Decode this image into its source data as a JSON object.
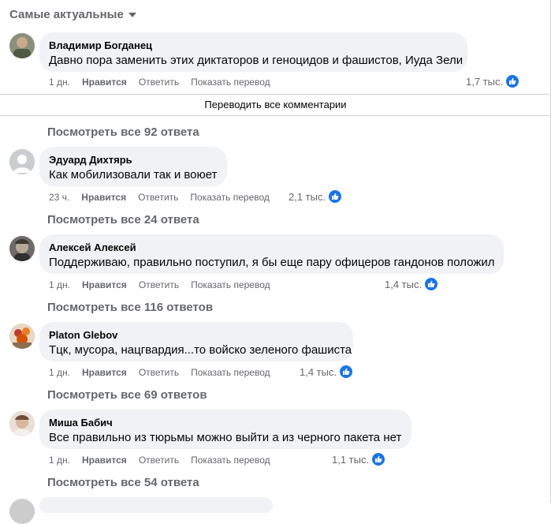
{
  "header": {
    "sort_label": "Самые актуальные"
  },
  "translate_all": "Переводить все комментарии",
  "comments": [
    {
      "author": "Владимир Богданец",
      "text": "Давно пора заменить этих диктаторов и геноцидов и фашистов, Иуда Зели",
      "time": "1 дн.",
      "like": "Нравится",
      "reply": "Ответить",
      "translate": "Показать перевод",
      "reactions": "1,7 тыс.",
      "view_replies": "Посмотреть все 92 ответа"
    },
    {
      "author": "Эдуард Дихтярь",
      "text": "Как мобилизовали так и воюет",
      "time": "23 ч.",
      "like": "Нравится",
      "reply": "Ответить",
      "translate": "Показать перевод",
      "reactions": "2,1 тыс.",
      "view_replies": "Посмотреть все 24 ответа"
    },
    {
      "author": "Алексей Алексей",
      "text": "Поддерживаю, правильно поступил, я бы еще пару офицеров гандонов положил",
      "time": "1 дн.",
      "like": "Нравится",
      "reply": "Ответить",
      "translate": "Показать перевод",
      "reactions": "1,4 тыс.",
      "view_replies": "Посмотреть все 116 ответов"
    },
    {
      "author": "Platon Glebov",
      "text": "Тцк, мусора, нацгвардия...то войско зеленого фашиста",
      "time": "1 дн.",
      "like": "Нравится",
      "reply": "Ответить",
      "translate": "Показать перевод",
      "reactions": "1,4 тыс.",
      "view_replies": "Посмотреть все 69 ответов"
    },
    {
      "author": "Миша Бабич",
      "text": "Все правильно из тюрьмы можно выйти а из черного пакета нет",
      "time": "1 дн.",
      "like": "Нравится",
      "reply": "Ответить",
      "translate": "Показать перевод",
      "reactions": "1,1 тыс.",
      "view_replies": "Посмотреть все 54 ответа"
    }
  ]
}
